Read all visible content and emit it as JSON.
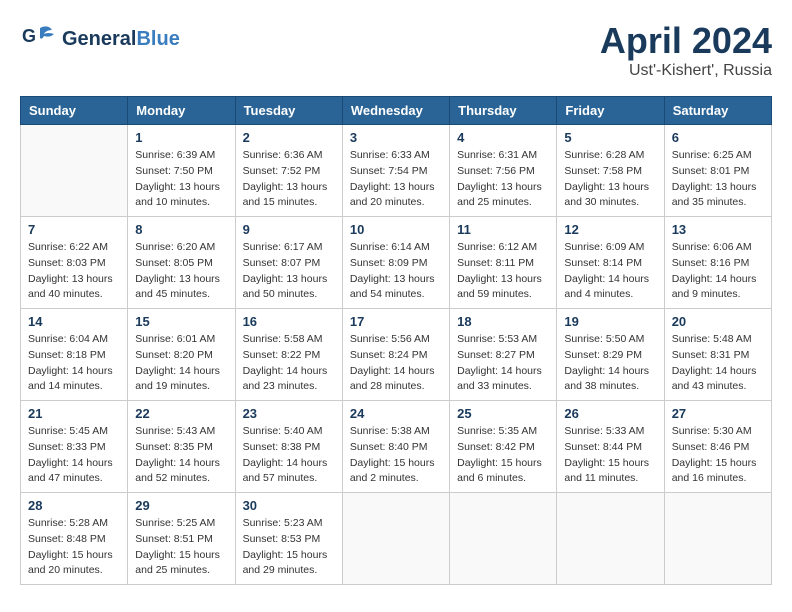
{
  "header": {
    "logo_general": "General",
    "logo_blue": "Blue",
    "month": "April 2024",
    "location": "Ust'-Kishert', Russia"
  },
  "days_of_week": [
    "Sunday",
    "Monday",
    "Tuesday",
    "Wednesday",
    "Thursday",
    "Friday",
    "Saturday"
  ],
  "weeks": [
    [
      {
        "day": "",
        "sunrise": "",
        "sunset": "",
        "daylight": ""
      },
      {
        "day": "1",
        "sunrise": "Sunrise: 6:39 AM",
        "sunset": "Sunset: 7:50 PM",
        "daylight": "Daylight: 13 hours and 10 minutes."
      },
      {
        "day": "2",
        "sunrise": "Sunrise: 6:36 AM",
        "sunset": "Sunset: 7:52 PM",
        "daylight": "Daylight: 13 hours and 15 minutes."
      },
      {
        "day": "3",
        "sunrise": "Sunrise: 6:33 AM",
        "sunset": "Sunset: 7:54 PM",
        "daylight": "Daylight: 13 hours and 20 minutes."
      },
      {
        "day": "4",
        "sunrise": "Sunrise: 6:31 AM",
        "sunset": "Sunset: 7:56 PM",
        "daylight": "Daylight: 13 hours and 25 minutes."
      },
      {
        "day": "5",
        "sunrise": "Sunrise: 6:28 AM",
        "sunset": "Sunset: 7:58 PM",
        "daylight": "Daylight: 13 hours and 30 minutes."
      },
      {
        "day": "6",
        "sunrise": "Sunrise: 6:25 AM",
        "sunset": "Sunset: 8:01 PM",
        "daylight": "Daylight: 13 hours and 35 minutes."
      }
    ],
    [
      {
        "day": "7",
        "sunrise": "Sunrise: 6:22 AM",
        "sunset": "Sunset: 8:03 PM",
        "daylight": "Daylight: 13 hours and 40 minutes."
      },
      {
        "day": "8",
        "sunrise": "Sunrise: 6:20 AM",
        "sunset": "Sunset: 8:05 PM",
        "daylight": "Daylight: 13 hours and 45 minutes."
      },
      {
        "day": "9",
        "sunrise": "Sunrise: 6:17 AM",
        "sunset": "Sunset: 8:07 PM",
        "daylight": "Daylight: 13 hours and 50 minutes."
      },
      {
        "day": "10",
        "sunrise": "Sunrise: 6:14 AM",
        "sunset": "Sunset: 8:09 PM",
        "daylight": "Daylight: 13 hours and 54 minutes."
      },
      {
        "day": "11",
        "sunrise": "Sunrise: 6:12 AM",
        "sunset": "Sunset: 8:11 PM",
        "daylight": "Daylight: 13 hours and 59 minutes."
      },
      {
        "day": "12",
        "sunrise": "Sunrise: 6:09 AM",
        "sunset": "Sunset: 8:14 PM",
        "daylight": "Daylight: 14 hours and 4 minutes."
      },
      {
        "day": "13",
        "sunrise": "Sunrise: 6:06 AM",
        "sunset": "Sunset: 8:16 PM",
        "daylight": "Daylight: 14 hours and 9 minutes."
      }
    ],
    [
      {
        "day": "14",
        "sunrise": "Sunrise: 6:04 AM",
        "sunset": "Sunset: 8:18 PM",
        "daylight": "Daylight: 14 hours and 14 minutes."
      },
      {
        "day": "15",
        "sunrise": "Sunrise: 6:01 AM",
        "sunset": "Sunset: 8:20 PM",
        "daylight": "Daylight: 14 hours and 19 minutes."
      },
      {
        "day": "16",
        "sunrise": "Sunrise: 5:58 AM",
        "sunset": "Sunset: 8:22 PM",
        "daylight": "Daylight: 14 hours and 23 minutes."
      },
      {
        "day": "17",
        "sunrise": "Sunrise: 5:56 AM",
        "sunset": "Sunset: 8:24 PM",
        "daylight": "Daylight: 14 hours and 28 minutes."
      },
      {
        "day": "18",
        "sunrise": "Sunrise: 5:53 AM",
        "sunset": "Sunset: 8:27 PM",
        "daylight": "Daylight: 14 hours and 33 minutes."
      },
      {
        "day": "19",
        "sunrise": "Sunrise: 5:50 AM",
        "sunset": "Sunset: 8:29 PM",
        "daylight": "Daylight: 14 hours and 38 minutes."
      },
      {
        "day": "20",
        "sunrise": "Sunrise: 5:48 AM",
        "sunset": "Sunset: 8:31 PM",
        "daylight": "Daylight: 14 hours and 43 minutes."
      }
    ],
    [
      {
        "day": "21",
        "sunrise": "Sunrise: 5:45 AM",
        "sunset": "Sunset: 8:33 PM",
        "daylight": "Daylight: 14 hours and 47 minutes."
      },
      {
        "day": "22",
        "sunrise": "Sunrise: 5:43 AM",
        "sunset": "Sunset: 8:35 PM",
        "daylight": "Daylight: 14 hours and 52 minutes."
      },
      {
        "day": "23",
        "sunrise": "Sunrise: 5:40 AM",
        "sunset": "Sunset: 8:38 PM",
        "daylight": "Daylight: 14 hours and 57 minutes."
      },
      {
        "day": "24",
        "sunrise": "Sunrise: 5:38 AM",
        "sunset": "Sunset: 8:40 PM",
        "daylight": "Daylight: 15 hours and 2 minutes."
      },
      {
        "day": "25",
        "sunrise": "Sunrise: 5:35 AM",
        "sunset": "Sunset: 8:42 PM",
        "daylight": "Daylight: 15 hours and 6 minutes."
      },
      {
        "day": "26",
        "sunrise": "Sunrise: 5:33 AM",
        "sunset": "Sunset: 8:44 PM",
        "daylight": "Daylight: 15 hours and 11 minutes."
      },
      {
        "day": "27",
        "sunrise": "Sunrise: 5:30 AM",
        "sunset": "Sunset: 8:46 PM",
        "daylight": "Daylight: 15 hours and 16 minutes."
      }
    ],
    [
      {
        "day": "28",
        "sunrise": "Sunrise: 5:28 AM",
        "sunset": "Sunset: 8:48 PM",
        "daylight": "Daylight: 15 hours and 20 minutes."
      },
      {
        "day": "29",
        "sunrise": "Sunrise: 5:25 AM",
        "sunset": "Sunset: 8:51 PM",
        "daylight": "Daylight: 15 hours and 25 minutes."
      },
      {
        "day": "30",
        "sunrise": "Sunrise: 5:23 AM",
        "sunset": "Sunset: 8:53 PM",
        "daylight": "Daylight: 15 hours and 29 minutes."
      },
      {
        "day": "",
        "sunrise": "",
        "sunset": "",
        "daylight": ""
      },
      {
        "day": "",
        "sunrise": "",
        "sunset": "",
        "daylight": ""
      },
      {
        "day": "",
        "sunrise": "",
        "sunset": "",
        "daylight": ""
      },
      {
        "day": "",
        "sunrise": "",
        "sunset": "",
        "daylight": ""
      }
    ]
  ]
}
